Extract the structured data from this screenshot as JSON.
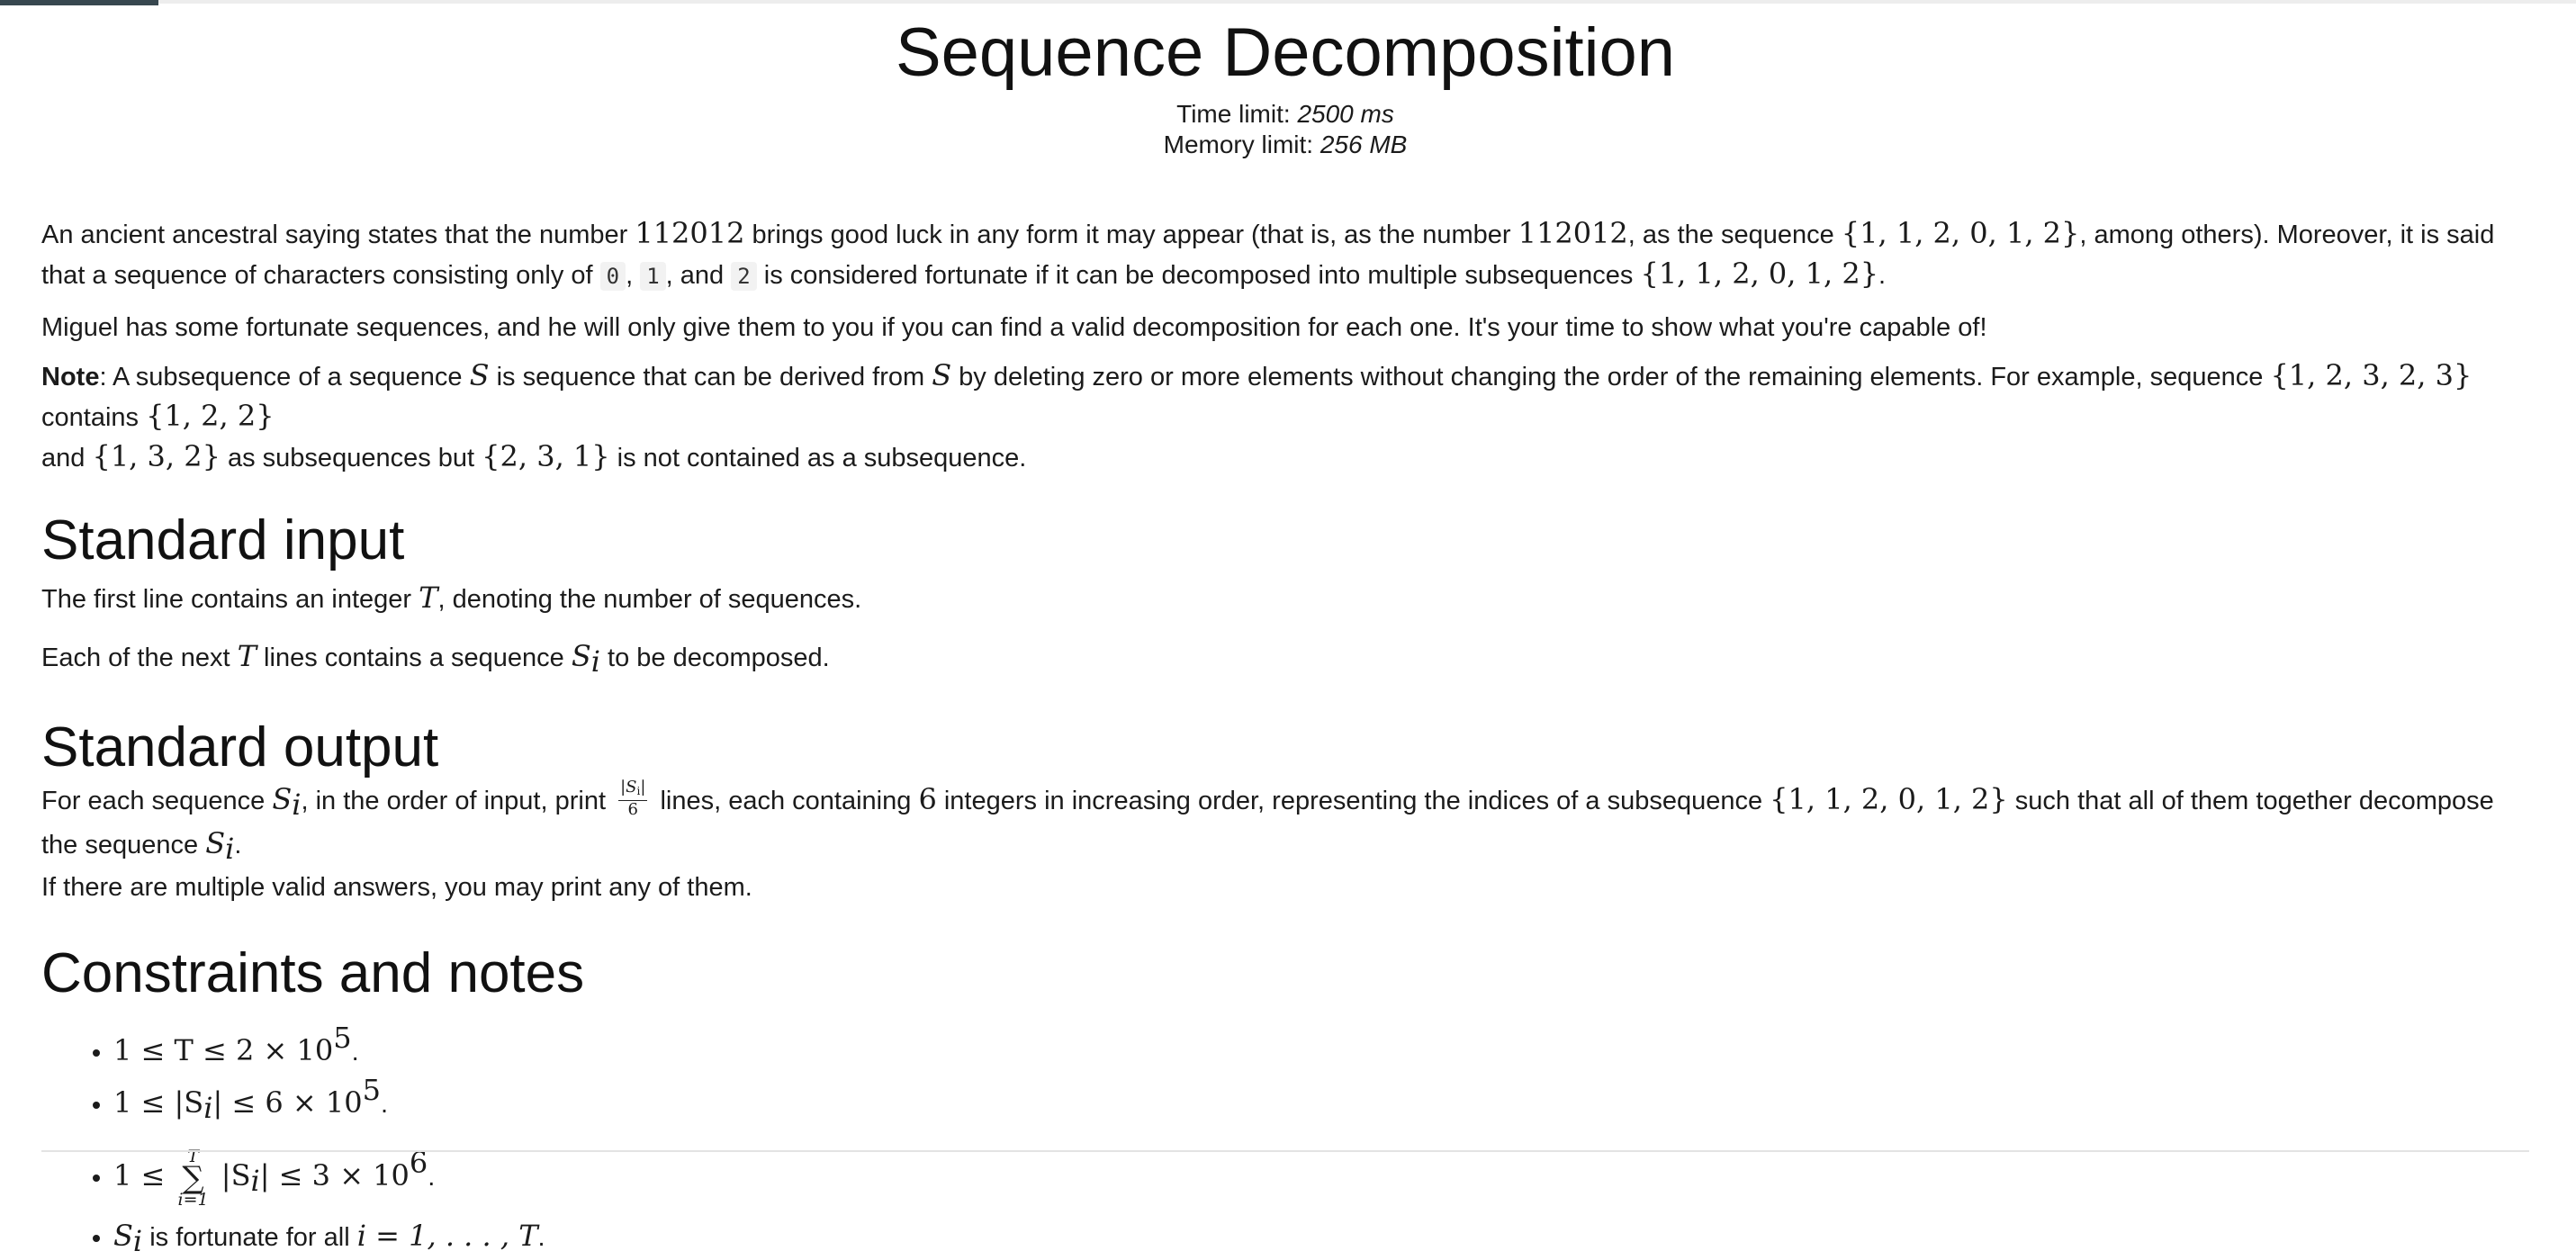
{
  "problem": {
    "title": "Sequence Decomposition",
    "time_limit_label": "Time limit: ",
    "time_limit_value": "2500 ms",
    "memory_limit_label": "Memory limit: ",
    "memory_limit_value": "256 MB"
  },
  "statement": {
    "p1_a": "An ancient ancestral saying states that the number ",
    "num_112012": "112012",
    "p1_b": " brings good luck in any form it may appear (that is, as the number ",
    "p1_c": ", as the sequence ",
    "seq_112012": "{1, 1, 2, 0, 1, 2}",
    "p1_d": ", among others). Moreover, it is said that a sequence of characters consisting only of ",
    "code0": "0",
    "comma": ",",
    "code1": "1",
    "p1_and": ", and ",
    "code2": "2",
    "p1_e": " is considered fortunate if it can be decomposed into multiple subsequences ",
    "period": ".",
    "p2": "Miguel has some fortunate sequences, and he will only give them to you if you can find a valid decomposition for each one. It's your time to show what you're capable of!",
    "note_label": "Note",
    "note_a": ": A subsequence of a sequence ",
    "S": "S",
    "note_b": " is sequence that can be derived from ",
    "note_c": " by deleting zero or more elements without changing the order of the remaining elements. For example, sequence ",
    "seq_12323": "{1, 2, 3, 2, 3}",
    "note_d": " contains ",
    "seq_122": "{1, 2, 2}",
    "note_e": "and ",
    "seq_132": "{1, 3, 2}",
    "note_f": " as subsequences but ",
    "seq_231": "{2, 3, 1}",
    "note_g": " is not contained as a subsequence."
  },
  "input_section": {
    "heading": "Standard input",
    "line1_a": "The first line contains an integer ",
    "T": "T",
    "line1_b": ", denoting the number of sequences.",
    "line2_a": "Each of the next ",
    "line2_b": " lines contains a sequence ",
    "Si_S": "S",
    "Si_i": "i",
    "line2_c": " to be decomposed."
  },
  "output_section": {
    "heading": "Standard output",
    "a": "For each sequence ",
    "b": ", in the order of input, print ",
    "frac_num": "|S",
    "frac_num_sub": "i",
    "frac_num_end": "|",
    "frac_den": "6",
    "c": " lines, each containing ",
    "six": "6",
    "d": " integers in increasing order, representing the indices of a subsequence ",
    "e": " such that all of them together decompose the sequence ",
    "f": ".",
    "g": "If there are multiple valid answers, you may print any of them."
  },
  "constraints_section": {
    "heading": "Constraints and notes",
    "c1": "1 ≤ T ≤ 2 × 10",
    "c1_exp": "5",
    "c2": "1 ≤ |S",
    "c2_b": "| ≤ 6 × 10",
    "c2_exp": "5",
    "c3_a": "1 ≤ ",
    "sum_top": "T",
    "sum_sig": "∑",
    "sum_bot": "i=1",
    "c3_b": " |S",
    "c3_c": "| ≤ 3 × 10",
    "c3_exp": "6",
    "c4_a": " is fortunate for all ",
    "c4_b": "i = 1, . . . , T",
    "dot": "."
  }
}
